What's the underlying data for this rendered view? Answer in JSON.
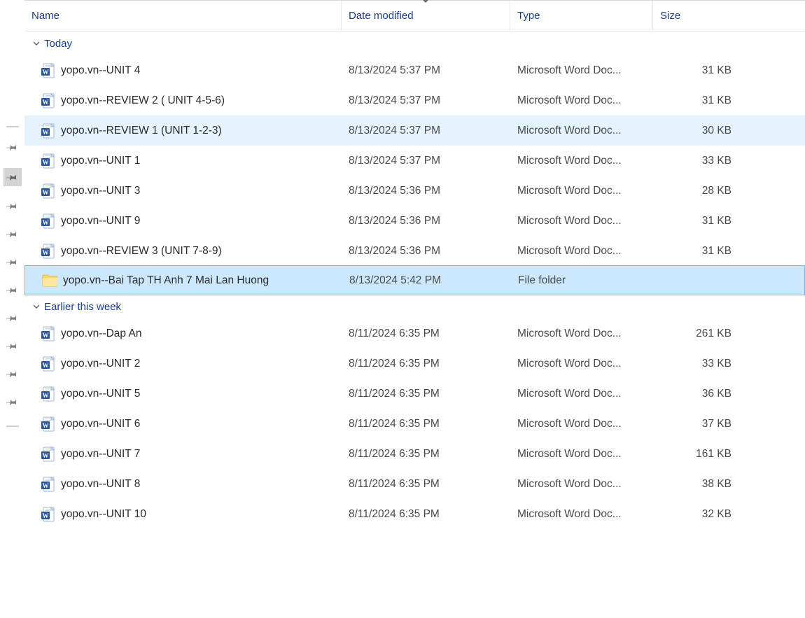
{
  "columns": {
    "name": "Name",
    "date": "Date modified",
    "type": "Type",
    "size": "Size"
  },
  "groups": [
    {
      "label": "Today",
      "items": [
        {
          "icon": "word",
          "name": "yopo.vn--UNIT 4",
          "date": "8/13/2024 5:37 PM",
          "type": "Microsoft Word Doc...",
          "size": "31 KB",
          "state": ""
        },
        {
          "icon": "word",
          "name": "yopo.vn--REVIEW 2 ( UNIT 4-5-6)",
          "date": "8/13/2024 5:37 PM",
          "type": "Microsoft Word Doc...",
          "size": "31 KB",
          "state": ""
        },
        {
          "icon": "word",
          "name": "yopo.vn--REVIEW 1 (UNIT 1-2-3)",
          "date": "8/13/2024 5:37 PM",
          "type": "Microsoft Word Doc...",
          "size": "30 KB",
          "state": "hover"
        },
        {
          "icon": "word",
          "name": "yopo.vn--UNIT 1",
          "date": "8/13/2024 5:37 PM",
          "type": "Microsoft Word Doc...",
          "size": "33 KB",
          "state": ""
        },
        {
          "icon": "word",
          "name": "yopo.vn--UNIT 3",
          "date": "8/13/2024 5:36 PM",
          "type": "Microsoft Word Doc...",
          "size": "28 KB",
          "state": ""
        },
        {
          "icon": "word",
          "name": "yopo.vn--UNIT 9",
          "date": "8/13/2024 5:36 PM",
          "type": "Microsoft Word Doc...",
          "size": "31 KB",
          "state": ""
        },
        {
          "icon": "word",
          "name": "yopo.vn--REVIEW 3 (UNIT 7-8-9)",
          "date": "8/13/2024 5:36 PM",
          "type": "Microsoft Word Doc...",
          "size": "31 KB",
          "state": ""
        },
        {
          "icon": "folder",
          "name": "yopo.vn--Bai Tap TH Anh 7  Mai Lan Huong",
          "date": "8/13/2024 5:42 PM",
          "type": "File folder",
          "size": "",
          "state": "selected"
        }
      ]
    },
    {
      "label": "Earlier this week",
      "items": [
        {
          "icon": "word",
          "name": "yopo.vn--Dap An",
          "date": "8/11/2024 6:35 PM",
          "type": "Microsoft Word Doc...",
          "size": "261 KB",
          "state": ""
        },
        {
          "icon": "word",
          "name": "yopo.vn--UNIT 2",
          "date": "8/11/2024 6:35 PM",
          "type": "Microsoft Word Doc...",
          "size": "33 KB",
          "state": ""
        },
        {
          "icon": "word",
          "name": "yopo.vn--UNIT 5",
          "date": "8/11/2024 6:35 PM",
          "type": "Microsoft Word Doc...",
          "size": "36 KB",
          "state": ""
        },
        {
          "icon": "word",
          "name": "yopo.vn--UNIT 6",
          "date": "8/11/2024 6:35 PM",
          "type": "Microsoft Word Doc...",
          "size": "37 KB",
          "state": ""
        },
        {
          "icon": "word",
          "name": "yopo.vn--UNIT 7",
          "date": "8/11/2024 6:35 PM",
          "type": "Microsoft Word Doc...",
          "size": "161 KB",
          "state": ""
        },
        {
          "icon": "word",
          "name": "yopo.vn--UNIT 8",
          "date": "8/11/2024 6:35 PM",
          "type": "Microsoft Word Doc...",
          "size": "38 KB",
          "state": ""
        },
        {
          "icon": "word",
          "name": "yopo.vn--UNIT 10",
          "date": "8/11/2024 6:35 PM",
          "type": "Microsoft Word Doc...",
          "size": "32 KB",
          "state": ""
        }
      ]
    }
  ]
}
